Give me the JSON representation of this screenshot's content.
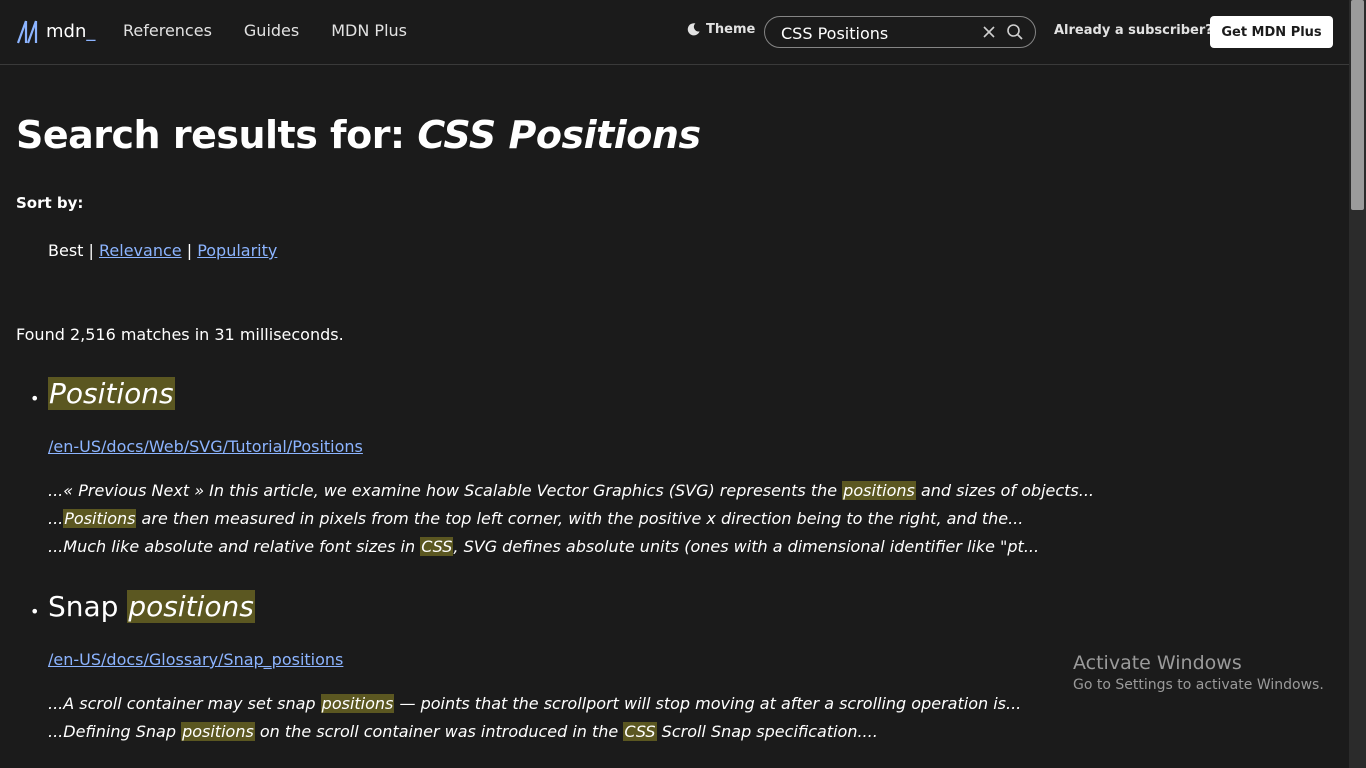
{
  "header": {
    "logo_text": "mdn",
    "logo_underscore": "_",
    "nav": [
      "References",
      "Guides",
      "MDN Plus"
    ],
    "theme_label": "Theme",
    "search_value": "CSS Positions",
    "subscriber_label": "Already a subscriber?",
    "get_plus_label": "Get MDN Plus"
  },
  "page": {
    "title_prefix": "Search results for: ",
    "title_query": "CSS Positions",
    "sort_label": "Sort by:",
    "sort_options": {
      "best": "Best",
      "relevance": "Relevance",
      "popularity": "Popularity"
    },
    "found_text": "Found 2,516 matches in 31 milliseconds."
  },
  "results": [
    {
      "title_pre": "",
      "title_mark": "Positions",
      "url": "/en-US/docs/Web/SVG/Tutorial/Positions",
      "lines": [
        [
          "...« Previous Next » In this article, we examine how Scalable Vector Graphics (SVG) represents the ",
          "positions",
          " and sizes of objects..."
        ],
        [
          "...",
          "Positions",
          " are then measured in pixels from the top left corner, with the positive x direction being to the right, and the..."
        ],
        [
          "...Much like absolute and relative font sizes in ",
          "CSS",
          ", SVG defines absolute units (ones with a dimensional identifier like \"pt..."
        ]
      ]
    },
    {
      "title_pre": "Snap ",
      "title_mark": "positions",
      "url": "/en-US/docs/Glossary/Snap_positions",
      "lines": [
        [
          "...A scroll container may set snap ",
          "positions",
          " — points that the scrollport will stop moving at after a scrolling operation is..."
        ],
        [
          "...Defining Snap ",
          "positions",
          " on the scroll container was introduced in the ",
          "CSS",
          " Scroll Snap specification...."
        ]
      ]
    }
  ],
  "watermark": {
    "line1": "Activate Windows",
    "line2": "Go to Settings to activate Windows."
  },
  "colors": {
    "background": "#1b1b1b",
    "link": "#8cb4ff",
    "highlight": "#5b5721"
  }
}
